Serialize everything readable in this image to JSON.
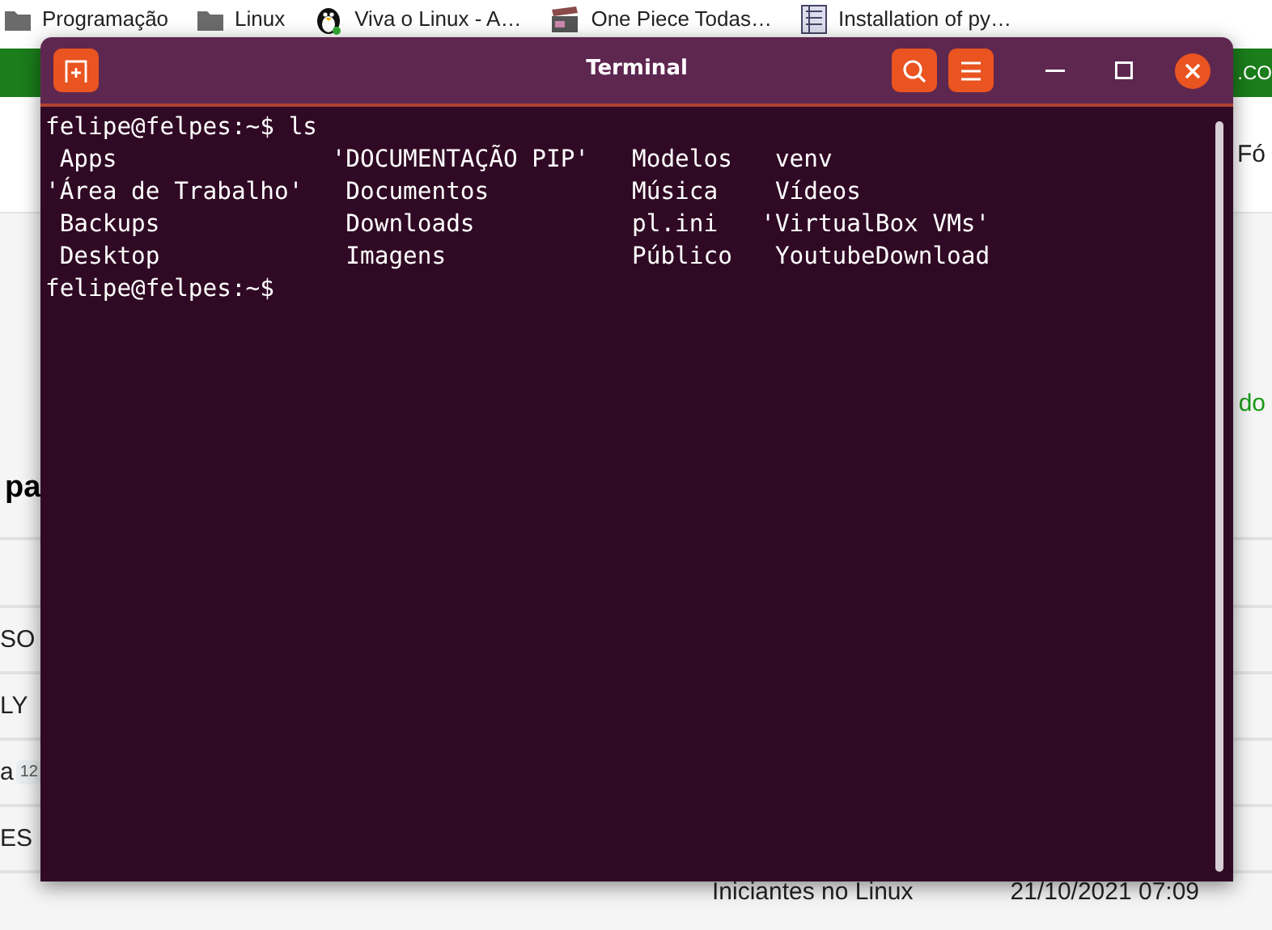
{
  "bookmarks": [
    {
      "label": "Programação",
      "kind": "folder"
    },
    {
      "label": "Linux",
      "kind": "folder"
    },
    {
      "label": "Viva o Linux - A…",
      "kind": "penguin"
    },
    {
      "label": "One Piece Todas…",
      "kind": "clapper"
    },
    {
      "label": "Installation of py…",
      "kind": "doc"
    }
  ],
  "page": {
    "banner_text": ".CO",
    "nav_text": "Fó",
    "rss_text": "do",
    "heading": "pa",
    "rows": [
      {
        "title": "SO"
      },
      {
        "title": "LY"
      },
      {
        "title": "a",
        "count": "12"
      },
      {
        "title": "ES"
      }
    ],
    "last_row": {
      "community": "Iniciantes no Linux",
      "last_post": "21/10/2021 07:09"
    }
  },
  "terminal": {
    "title": "Terminal",
    "session": [
      {
        "prompt": "felipe@felpes:~$",
        "command": "ls",
        "output": [
          [
            {
              "name": "Apps",
              "kind": "plain"
            },
            {
              "name": "'DOCUMENTAÇÃO PIP'",
              "kind": "quoted"
            },
            {
              "name": "Modelos",
              "kind": "plain"
            },
            {
              "name": "venv",
              "kind": "plain"
            }
          ],
          [
            {
              "name": "'Área de Trabalho'",
              "kind": "quoted"
            },
            {
              "name": "Documentos",
              "kind": "plain"
            },
            {
              "name": "Música",
              "kind": "plain"
            },
            {
              "name": "Vídeos",
              "kind": "plain"
            }
          ],
          [
            {
              "name": "Backups",
              "kind": "plain"
            },
            {
              "name": "Downloads",
              "kind": "plain"
            },
            {
              "name": "pl.ini",
              "kind": "plain"
            },
            {
              "name": "'VirtualBox VMs'",
              "kind": "quoted"
            }
          ],
          [
            {
              "name": "Desktop",
              "kind": "plain"
            },
            {
              "name": "Imagens",
              "kind": "plain"
            },
            {
              "name": "Público",
              "kind": "plain"
            },
            {
              "name": "YoutubeDownload",
              "kind": "plain"
            }
          ]
        ]
      },
      {
        "prompt": "felipe@felpes:~$"
      }
    ]
  }
}
